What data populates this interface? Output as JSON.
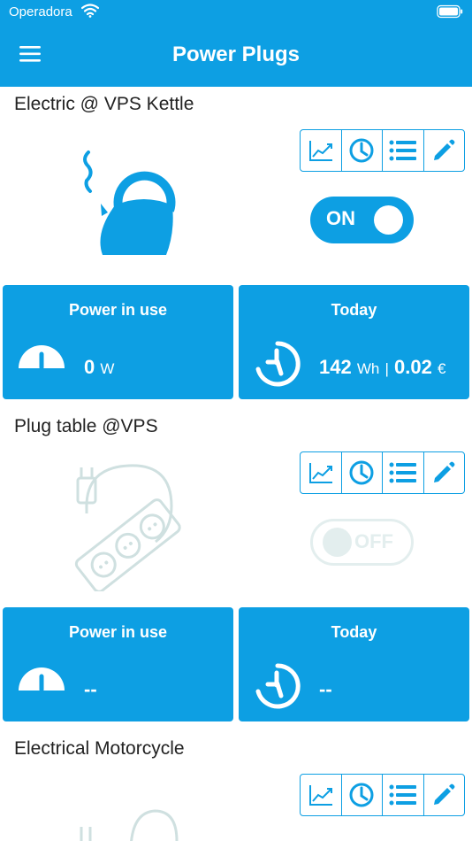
{
  "status_bar": {
    "carrier": "Operadora"
  },
  "header": {
    "title": "Power Plugs"
  },
  "colors": {
    "accent": "#0d9fe3",
    "disabled": "#e3eeee",
    "disabled_icon": "#cfe0e0"
  },
  "devices": [
    {
      "name": "Electric @ VPS Kettle",
      "icon": "kettle-icon",
      "toggle": {
        "state": "on",
        "label": "ON"
      },
      "power": {
        "title": "Power in use",
        "value": "0",
        "unit": "W"
      },
      "today": {
        "title": "Today",
        "energy": "142",
        "energy_unit": "Wh",
        "separator": "|",
        "cost": "0.02",
        "currency": "€"
      }
    },
    {
      "name": "Plug table @VPS",
      "icon": "power-strip-icon",
      "toggle": {
        "state": "off",
        "label": "OFF"
      },
      "power": {
        "title": "Power in use",
        "value": "--"
      },
      "today": {
        "title": "Today",
        "value": "--"
      }
    },
    {
      "name": "Electrical Motorcycle",
      "icon": "plug-icon"
    }
  ]
}
